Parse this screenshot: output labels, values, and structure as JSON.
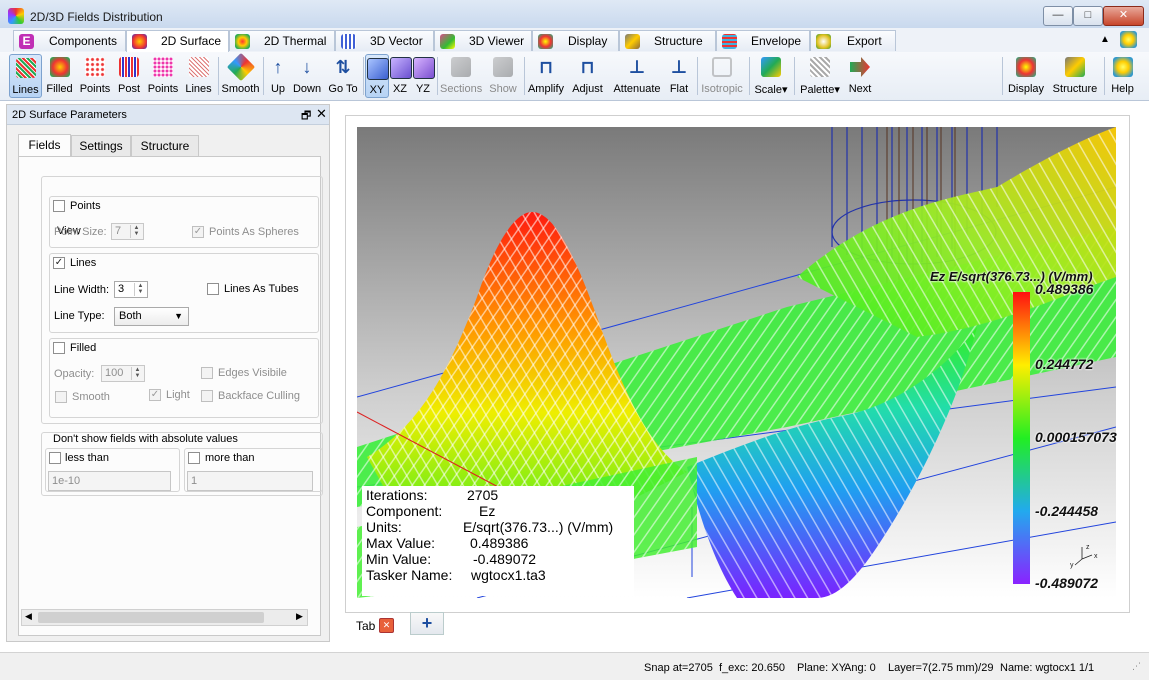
{
  "window": {
    "title": "2D/3D Fields Distribution",
    "min": "—",
    "max": "□",
    "close": "✕"
  },
  "module_tabs": [
    {
      "label": "Components",
      "color": "#c02fb5"
    },
    {
      "label": "2D Surface",
      "color": "#e84a2a",
      "active": true
    },
    {
      "label": "2D Thermal",
      "color": "#1f8a3a"
    },
    {
      "label": "3D Vector",
      "color": "#3f5fd6"
    },
    {
      "label": "3D Viewer",
      "color": "#d94d8c"
    },
    {
      "label": "Display",
      "color": "#d97d20"
    },
    {
      "label": "Structure",
      "color": "#8c6a3a"
    },
    {
      "label": "Envelope",
      "color": "#3fb2e0"
    },
    {
      "label": "Export",
      "color": "#e0c020"
    }
  ],
  "module_tabs_extra": "▲",
  "toolbar": {
    "lines": "Lines",
    "filled": "Filled",
    "points": "Points",
    "post": "Post",
    "points2": "Points",
    "lines2": "Lines",
    "smooth": "Smooth",
    "up": "Up",
    "down": "Down",
    "goto": "Go To",
    "xy": "XY",
    "xz": "XZ",
    "yz": "YZ",
    "sections": "Sections",
    "show": "Show",
    "amplify": "Amplify",
    "adjust": "Adjust",
    "attenuate": "Attenuate",
    "flat": "Flat",
    "isotropic": "Isotropic",
    "scale": "Scale",
    "palette": "Palette",
    "next": "Next",
    "display": "Display",
    "structure": "Structure",
    "help": "Help"
  },
  "panel": {
    "title": "2D Surface Parameters",
    "float": "🗗",
    "close": "✕",
    "tabs": [
      "Fields",
      "Settings",
      "Structure"
    ],
    "view_group": "View",
    "points_label": "Points",
    "point_size_label": "Point Size:",
    "point_size_value": "7",
    "points_as_spheres": "Points As Spheres",
    "lines_label": "Lines",
    "line_width_label": "Line Width:",
    "line_width_value": "3",
    "lines_as_tubes": "Lines As Tubes",
    "line_type_label": "Line Type:",
    "line_type_value": "Both",
    "filled_label": "Filled",
    "opacity_label": "Opacity:",
    "opacity_value": "100",
    "edges_visible": "Edges Visibile",
    "smooth_label": "Smooth",
    "light_label": "Light",
    "backface_culling": "Backface Culling",
    "abs_group": "Don't show fields with absolute values",
    "less_than": "less than",
    "less_than_value": "1e-10",
    "more_than": "more than",
    "more_than_value": "1",
    "check": "✓"
  },
  "viewer": {
    "colorbar_title": "Ez E/sqrt(376.73...) (V/mm)",
    "colorbar_ticks": [
      "0.489386",
      "0.244772",
      "0.000157073",
      "-0.244458",
      "-0.489072"
    ],
    "info": {
      "iterations_label": "Iterations:",
      "iterations_value": "2705",
      "component_label": "Component:",
      "component_value": "Ez",
      "units_label": "Units:",
      "units_value": "E/sqrt(376.73...) (V/mm)",
      "max_label": "Max Value:",
      "max_value": "0.489386",
      "min_label": "Min Value:",
      "min_value": "-0.489072",
      "tasker_label": "Tasker Name:",
      "tasker_value": "wgtocx1.ta3"
    },
    "tab_label": "Tab",
    "tab_close": "✕",
    "tab_add": "+"
  },
  "status": {
    "snap": "Snap at=2705",
    "fexc": "f_exc: 20.650",
    "plane": "Plane: XY",
    "ang": "Ang:    0",
    "layer": "Layer=7(2.75 mm)/29",
    "name": "Name: wgtocx1 1/1"
  }
}
